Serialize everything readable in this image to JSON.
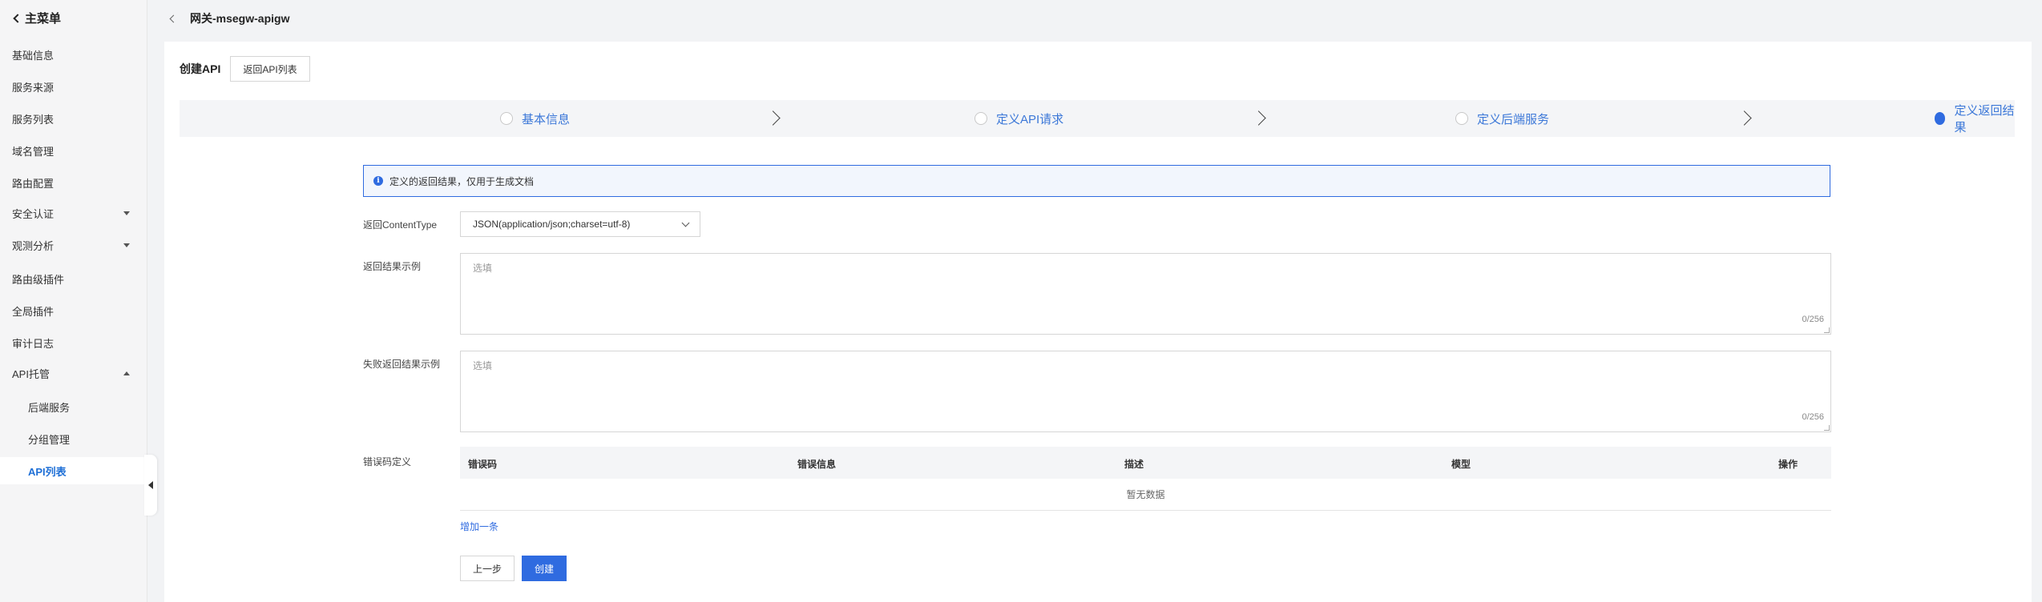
{
  "sidebar": {
    "back_label": "主菜单",
    "items": [
      {
        "label": "基础信息"
      },
      {
        "label": "服务来源"
      },
      {
        "label": "服务列表"
      },
      {
        "label": "域名管理"
      },
      {
        "label": "路由配置"
      },
      {
        "label": "安全认证"
      },
      {
        "label": "观测分析"
      },
      {
        "label": "路由级插件"
      },
      {
        "label": "全局插件"
      },
      {
        "label": "审计日志"
      },
      {
        "label": "API托管"
      },
      {
        "label": "后端服务"
      },
      {
        "label": "分组管理"
      },
      {
        "label": "API列表"
      }
    ]
  },
  "header": {
    "title": "网关-msegw-apigw"
  },
  "page": {
    "title": "创建API",
    "back_to_list": "返回API列表"
  },
  "steps": [
    {
      "label": "基本信息"
    },
    {
      "label": "定义API请求"
    },
    {
      "label": "定义后端服务"
    },
    {
      "label": "定义返回结果"
    }
  ],
  "notice": {
    "text": "定义的返回结果，仅用于生成文档"
  },
  "form": {
    "content_type_label": "返回ContentType",
    "content_type_value": "JSON(application/json;charset=utf-8)",
    "success_example_label": "返回结果示例",
    "success_example_placeholder": "选填",
    "success_example_counter": "0/256",
    "fail_example_label": "失败返回结果示例",
    "fail_example_placeholder": "选填",
    "fail_example_counter": "0/256",
    "error_code_label": "错误码定义"
  },
  "error_table": {
    "columns": [
      "错误码",
      "错误信息",
      "描述",
      "模型",
      "操作"
    ],
    "empty_text": "暂无数据",
    "add_label": "增加一条"
  },
  "actions": {
    "prev_label": "上一步",
    "create_label": "创建"
  },
  "colors": {
    "primary": "#2f6be0",
    "step_text": "#3c78d8"
  }
}
